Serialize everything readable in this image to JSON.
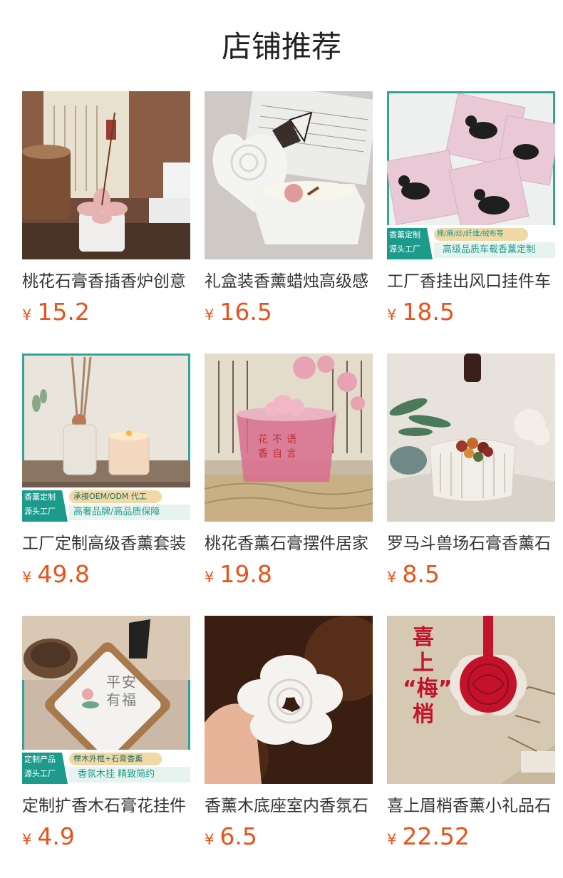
{
  "header": {
    "title": "店铺推荐"
  },
  "products": [
    {
      "title": "桃花石膏香插香炉创意",
      "currency": "¥",
      "price": "15.2",
      "image": "peach-flower-incense-holder"
    },
    {
      "title": "礼盒装香薰蜡烛高级感",
      "currency": "¥",
      "price": "16.5",
      "image": "gift-box-aroma-candle"
    },
    {
      "title": "工厂香挂出风口挂件车",
      "currency": "¥",
      "price": "18.5",
      "image": "car-vent-fragrance-boxes",
      "badge": {
        "left_top": "香薰定制",
        "left_bottom": "源头工厂",
        "tag": "棉/麻/纱/纤维/绒布等",
        "slogan": "高级品质车载香薰定制"
      }
    },
    {
      "title": "工厂定制高级香薰套装",
      "currency": "¥",
      "price": "49.8",
      "image": "reed-diffuser-candle-set",
      "badge": {
        "left_top": "香薰定制",
        "left_bottom": "源头工厂",
        "tag": "承接OEM/ODM 代工",
        "slogan": "高奢品牌/高品质保障"
      }
    },
    {
      "title": "桃花香薰石膏摆件居家",
      "currency": "¥",
      "price": "19.8",
      "image": "pink-glass-plaster-ornament",
      "overlay_text": [
        "花",
        "不",
        "语",
        "香",
        "自",
        "言"
      ]
    },
    {
      "title": "罗马斗兽场石膏香薰石",
      "currency": "¥",
      "price": "8.5",
      "image": "colosseum-plaster-aroma-stone"
    },
    {
      "title": "定制扩香木石膏花挂件",
      "currency": "¥",
      "price": "4.9",
      "image": "wood-frame-plaster-hanging",
      "badge": {
        "left_top": "定制产品",
        "left_bottom": "源头工厂",
        "tag": "榉木外框+石膏香薰",
        "slogan": "香氛木挂 精致简约"
      },
      "overlay_text": [
        "平",
        "安",
        "有",
        "福"
      ]
    },
    {
      "title": "香薰木底座室内香氛石",
      "currency": "¥",
      "price": "6.5",
      "image": "white-flower-plaster-in-hand"
    },
    {
      "title": "喜上眉梢香薰小礼品石",
      "currency": "¥",
      "price": "22.52",
      "image": "red-plum-hanging-pendant",
      "overlay_text": [
        "喜",
        "上",
        "“梅”",
        "梢"
      ]
    }
  ],
  "colors": {
    "accent_price": "#e8531b",
    "badge_teal": "#1c9b8c",
    "badge_gold": "#f1d9a6"
  }
}
